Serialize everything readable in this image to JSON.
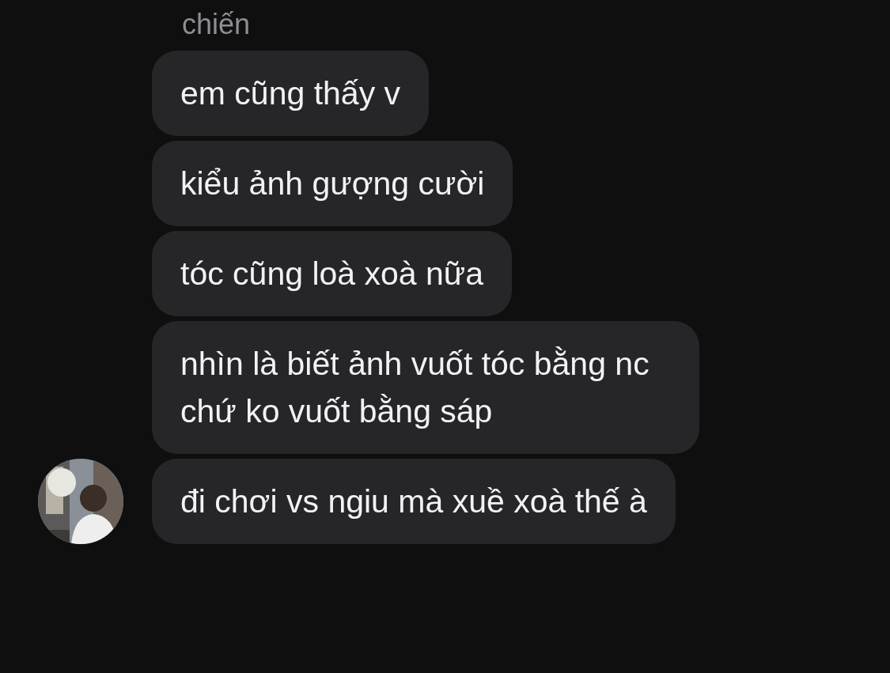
{
  "sender": {
    "name": "chiến"
  },
  "messages": [
    {
      "text": "em cũng thấy v"
    },
    {
      "text": "kiểu ảnh gượng cười"
    },
    {
      "text": "tóc cũng loà xoà nữa"
    },
    {
      "text": "nhìn là biết ảnh vuốt tóc bằng nc chứ ko vuốt bằng sáp"
    },
    {
      "text": "đi chơi vs ngiu mà xuề xoà thế à"
    }
  ]
}
